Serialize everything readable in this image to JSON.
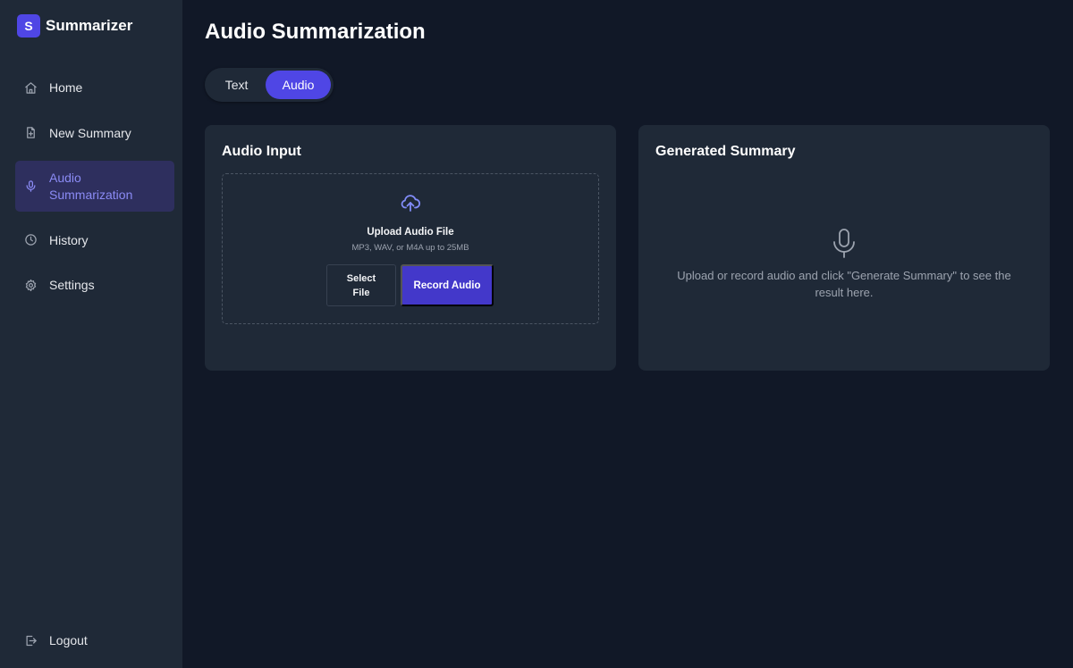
{
  "brand": {
    "logo_letter": "S",
    "name": "Summarizer"
  },
  "sidebar": {
    "items": [
      {
        "label": "Home",
        "icon": "home-icon"
      },
      {
        "label": "New Summary",
        "icon": "file-plus-icon"
      },
      {
        "label": "Audio Summarization",
        "icon": "mic-icon",
        "active": true
      },
      {
        "label": "History",
        "icon": "clock-icon"
      },
      {
        "label": "Settings",
        "icon": "gear-icon"
      }
    ],
    "logout": {
      "label": "Logout",
      "icon": "logout-icon"
    }
  },
  "page": {
    "title": "Audio Summarization"
  },
  "tabs": [
    {
      "label": "Text",
      "selected": false
    },
    {
      "label": "Audio",
      "selected": true
    }
  ],
  "audio_input": {
    "title": "Audio Input",
    "upload_title": "Upload Audio File",
    "upload_hint": "MP3, WAV, or M4A up to 25MB",
    "select_label": "Select File",
    "record_label": "Record Audio"
  },
  "summary": {
    "title": "Generated Summary",
    "empty_text": "Upload or record audio and click \"Generate Summary\" to see the result here."
  },
  "colors": {
    "accent": "#4f46e5",
    "sidebar_bg": "#1f2937",
    "page_bg": "#111827",
    "active_text": "#8b8bf5"
  }
}
